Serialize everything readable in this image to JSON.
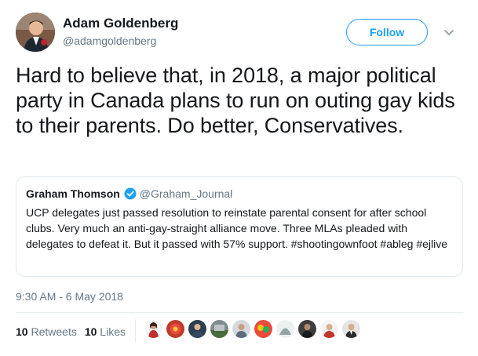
{
  "author": {
    "name": "Adam Goldenberg",
    "handle": "@adamgoldenberg"
  },
  "follow_label": "Follow",
  "tweet": {
    "text": "Hard to believe that, in 2018, a major political party in Canada plans to run on outing gay kids to their parents. Do better, Conservatives."
  },
  "quoted": {
    "name": "Graham Thomson",
    "handle": "@Graham_Journal",
    "text": "UCP delegates just passed resolution to reinstate parental consent for after school clubs. Very much an anti-gay-straight alliance move. Three MLAs pleaded with delegates to defeat it. But it passed with 57% support. #shootingownfoot #ableg #ejlive"
  },
  "timestamp": "9:30 AM - 6 May 2018",
  "stats": {
    "retweets_count": "10",
    "retweets_label": "Retweets",
    "likes_count": "10",
    "likes_label": "Likes"
  },
  "colors": {
    "accent": "#1da1f2",
    "secondary_text": "#657786"
  },
  "icons": {
    "chevron": "chevron-down-icon",
    "verified": "verified-badge-icon"
  }
}
